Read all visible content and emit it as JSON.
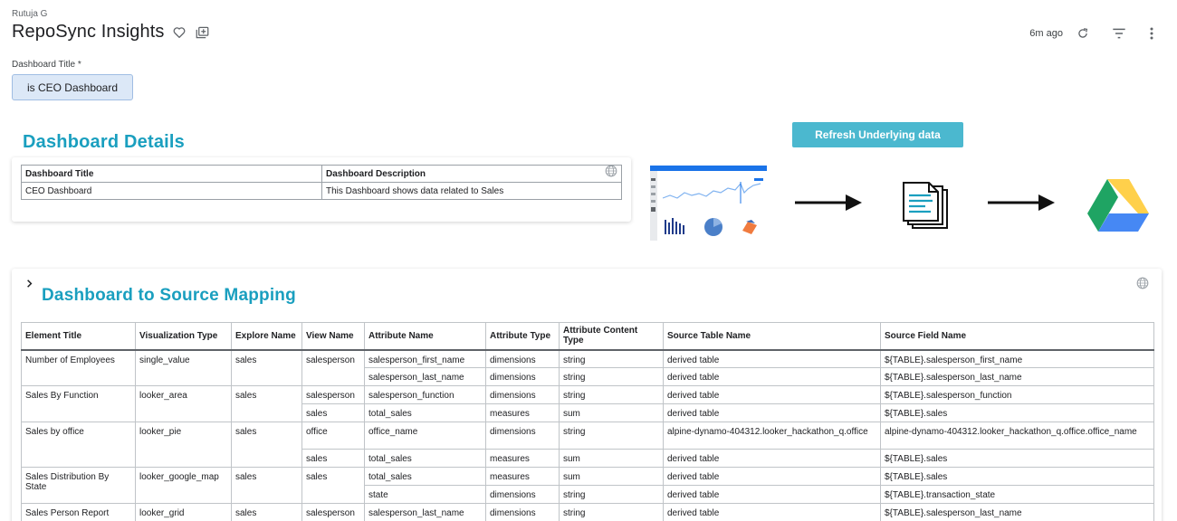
{
  "header": {
    "owner": "Rutuja G",
    "title": "RepoSync Insights",
    "updated": "6m ago"
  },
  "filter": {
    "label": "Dashboard Title *",
    "value": "is CEO Dashboard"
  },
  "details": {
    "heading": "Dashboard Details",
    "columns": [
      "Dashboard Title",
      "Dashboard Description"
    ],
    "rows": [
      [
        "CEO Dashboard",
        "This Dashboard shows data related to Sales"
      ]
    ]
  },
  "refresh_button": "Refresh Underlying data",
  "mapping": {
    "heading": "Dashboard to Source Mapping",
    "columns": [
      "Element Title",
      "Visualization Type",
      "Explore Name",
      "View Name",
      "Attribute Name",
      "Attribute Type",
      "Attribute Content Type",
      "Source Table Name",
      "Source Field Name"
    ],
    "rows": [
      [
        "Number of Employees",
        "single_value",
        "sales",
        "salesperson",
        "salesperson_first_name",
        "dimensions",
        "string",
        "derived table",
        "${TABLE}.salesperson_first_name"
      ],
      [
        "",
        "",
        "",
        "",
        "salesperson_last_name",
        "dimensions",
        "string",
        "derived table",
        "${TABLE}.salesperson_last_name"
      ],
      [
        "Sales By Function",
        "looker_area",
        "sales",
        "salesperson",
        "salesperson_function",
        "dimensions",
        "string",
        "derived table",
        "${TABLE}.salesperson_function"
      ],
      [
        "",
        "",
        "",
        "sales",
        "total_sales",
        "measures",
        "sum",
        "derived table",
        "${TABLE}.sales"
      ],
      [
        "Sales by office",
        "looker_pie",
        "sales",
        "office",
        "office_name",
        "dimensions",
        "string",
        "alpine-dynamo-404312.looker_hackathon_q.office",
        "alpine-dynamo-404312.looker_hackathon_q.office.office_name"
      ],
      [
        "",
        "",
        "",
        "sales",
        "total_sales",
        "measures",
        "sum",
        "derived table",
        "${TABLE}.sales"
      ],
      [
        "Sales Distribution By State",
        "looker_google_map",
        "sales",
        "sales",
        "total_sales",
        "measures",
        "sum",
        "derived table",
        "${TABLE}.sales"
      ],
      [
        "",
        "",
        "",
        "",
        "state",
        "dimensions",
        "string",
        "derived table",
        "${TABLE}.transaction_state"
      ],
      [
        "Sales Person Report",
        "looker_grid",
        "sales",
        "salesperson",
        "salesperson_last_name",
        "dimensions",
        "string",
        "derived table",
        "${TABLE}.salesperson_last_name"
      ]
    ]
  },
  "icons": {
    "favorite": "heart-outline-icon",
    "copy": "copy-to-board-icon",
    "reload": "reload-icon",
    "filter": "filter-lines-icon",
    "more": "more-vert-icon",
    "globe": "globe-icon",
    "expand": "chevron-right-icon",
    "flow": [
      "dashboard-thumbnail-icon",
      "arrow-right-icon",
      "documents-icon",
      "arrow-right-icon",
      "google-drive-icon"
    ]
  },
  "colors": {
    "accent": "#1a9fbf",
    "button": "#4bb8cf",
    "filter_chip": "#dce8f7",
    "drive_green": "#1fa463",
    "drive_yellow": "#ffd04b",
    "drive_blue": "#4688f4"
  }
}
